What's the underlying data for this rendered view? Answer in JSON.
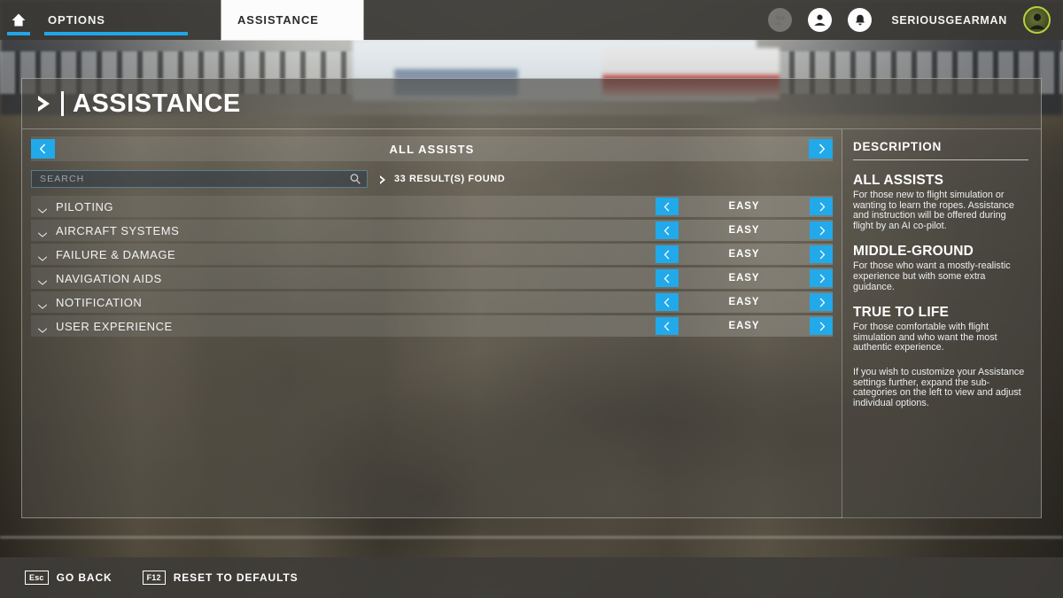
{
  "topbar": {
    "home_icon": "home-icon",
    "tabs": [
      {
        "label": "OPTIONS",
        "active": false
      },
      {
        "label": "ASSISTANCE",
        "active": true
      }
    ],
    "icons": [
      {
        "name": "friends-icon",
        "dim": true
      },
      {
        "name": "profile-icon",
        "dim": false
      },
      {
        "name": "notifications-bell-icon",
        "dim": false
      }
    ],
    "username": "SERIOUSGEARMAN",
    "avatar_name": "user-avatar"
  },
  "page": {
    "title": "ASSISTANCE",
    "title_icon": "chevron-right-icon"
  },
  "selector": {
    "prev_icon": "chevron-left-icon",
    "next_icon": "chevron-right-icon",
    "value": "ALL ASSISTS"
  },
  "search": {
    "placeholder": "SEARCH",
    "value": "",
    "icon": "search-icon",
    "results_icon": "chevron-right-icon",
    "results_text": "33 RESULT(S) FOUND"
  },
  "categories": [
    {
      "name": "PILOTING",
      "value": "EASY",
      "expand_icon": "chevron-down-icon"
    },
    {
      "name": "AIRCRAFT SYSTEMS",
      "value": "EASY",
      "expand_icon": "chevron-down-icon"
    },
    {
      "name": "FAILURE & DAMAGE",
      "value": "EASY",
      "expand_icon": "chevron-down-icon"
    },
    {
      "name": "NAVIGATION AIDS",
      "value": "EASY",
      "expand_icon": "chevron-down-icon"
    },
    {
      "name": "NOTIFICATION",
      "value": "EASY",
      "expand_icon": "chevron-down-icon"
    },
    {
      "name": "USER EXPERIENCE",
      "value": "EASY",
      "expand_icon": "chevron-down-icon"
    }
  ],
  "description": {
    "header": "DESCRIPTION",
    "sections": [
      {
        "heading": "ALL ASSISTS",
        "body": "For those new to flight simulation or wanting to learn the ropes. Assistance and instruction will be offered during flight by an AI co-pilot."
      },
      {
        "heading": "MIDDLE-GROUND",
        "body": "For those who want a mostly-realistic experience but with some extra guidance."
      },
      {
        "heading": "TRUE TO LIFE",
        "body": "For those comfortable with flight simulation and who want the most authentic experience."
      }
    ],
    "footer": "If you wish to customize your Assistance settings further, expand the sub-categories on the left to view and adjust individual options."
  },
  "bottombar": {
    "hints": [
      {
        "key": "Esc",
        "label": "GO BACK"
      },
      {
        "key": "F12",
        "label": "RESET TO DEFAULTS"
      }
    ]
  },
  "colors": {
    "accent_blue": "#21a9ea",
    "tab_underline": "#1fa7e8",
    "avatar_ring": "#b8cf3d",
    "text_primary": "#ffffff"
  }
}
